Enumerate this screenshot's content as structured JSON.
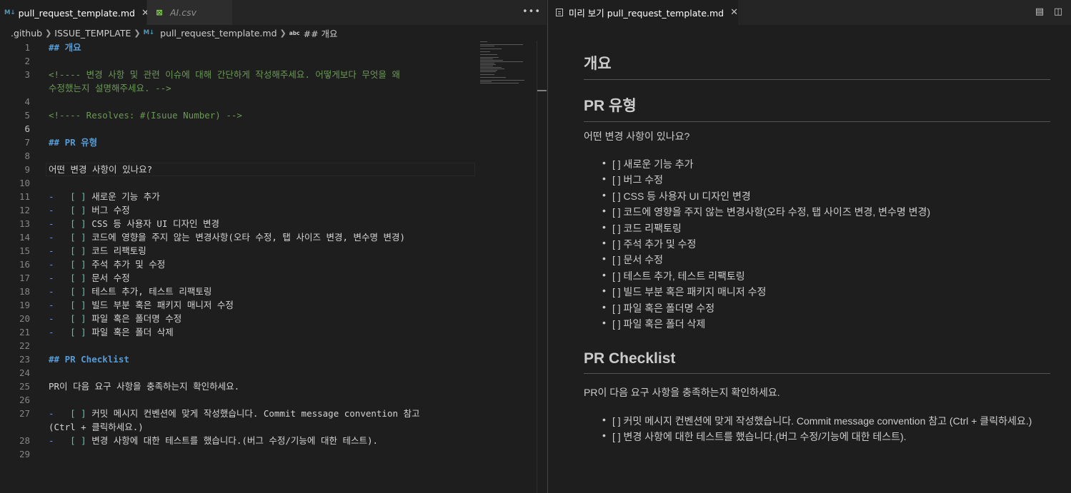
{
  "editor": {
    "tabs": [
      {
        "label": "pull_request_template.md",
        "icon": "markdown-file-icon",
        "active": true
      },
      {
        "label": "AI.csv",
        "icon": "csv-file-icon",
        "active": false
      }
    ],
    "more_actions_label": "•••",
    "breadcrumb": [
      ".github",
      "ISSUE_TEMPLATE",
      "pull_request_template.md",
      "## 개요"
    ],
    "lines": [
      {
        "n": "1",
        "text": "## 개요"
      },
      {
        "n": "2",
        "text": ""
      },
      {
        "n": "3",
        "text": "<!---- 변경 사항 및 관련 이슈에 대해 간단하게 작성해주세요. 어떻게보다 무엇을 왜"
      },
      {
        "n": "",
        "text": "수정했는지 설명해주세요. -->"
      },
      {
        "n": "4",
        "text": ""
      },
      {
        "n": "5",
        "text": "<!---- Resolves: #(Isuue Number) -->"
      },
      {
        "n": "6",
        "text": ""
      },
      {
        "n": "7",
        "text": "## PR 유형"
      },
      {
        "n": "8",
        "text": ""
      },
      {
        "n": "9",
        "text": "어떤 변경 사항이 있나요?"
      },
      {
        "n": "10",
        "text": ""
      },
      {
        "n": "11",
        "bullet": "-   ",
        "box": "[ ]",
        "text": " 새로운 기능 추가"
      },
      {
        "n": "12",
        "bullet": "-   ",
        "box": "[ ]",
        "text": " 버그 수정"
      },
      {
        "n": "13",
        "bullet": "-   ",
        "box": "[ ]",
        "text": " CSS 등 사용자 UI 디자인 변경"
      },
      {
        "n": "14",
        "bullet": "-   ",
        "box": "[ ]",
        "text": " 코드에 영향을 주지 않는 변경사항(오타 수정, 탭 사이즈 변경, 변수명 변경)"
      },
      {
        "n": "15",
        "bullet": "-   ",
        "box": "[ ]",
        "text": " 코드 리팩토링"
      },
      {
        "n": "16",
        "bullet": "-   ",
        "box": "[ ]",
        "text": " 주석 추가 및 수정"
      },
      {
        "n": "17",
        "bullet": "-   ",
        "box": "[ ]",
        "text": " 문서 수정"
      },
      {
        "n": "18",
        "bullet": "-   ",
        "box": "[ ]",
        "text": " 테스트 추가, 테스트 리팩토링"
      },
      {
        "n": "19",
        "bullet": "-   ",
        "box": "[ ]",
        "text": " 빌드 부분 혹은 패키지 매니저 수정"
      },
      {
        "n": "20",
        "bullet": "-   ",
        "box": "[ ]",
        "text": " 파일 혹은 폴더명 수정"
      },
      {
        "n": "21",
        "bullet": "-   ",
        "box": "[ ]",
        "text": " 파일 혹은 폴더 삭제"
      },
      {
        "n": "22",
        "text": ""
      },
      {
        "n": "23",
        "text": "## PR Checklist"
      },
      {
        "n": "24",
        "text": ""
      },
      {
        "n": "25",
        "text": "PR이 다음 요구 사항을 충족하는지 확인하세요."
      },
      {
        "n": "26",
        "text": ""
      },
      {
        "n": "27",
        "bullet": "-   ",
        "box": "[ ]",
        "text": " 커밋 메시지 컨벤션에 맞게 작성했습니다. Commit message convention 참고"
      },
      {
        "n": "",
        "text": "(Ctrl + 클릭하세요.)"
      },
      {
        "n": "28",
        "bullet": "-   ",
        "box": "[ ]",
        "text": " 변경 사항에 대한 테스트를 했습니다.(버그 수정/기능에 대한 테스트)."
      },
      {
        "n": "29",
        "text": ""
      }
    ]
  },
  "preview": {
    "tab_label": "미리 보기 pull_request_template.md",
    "h1": "개요",
    "h2_type": "PR 유형",
    "type_question": "어떤 변경 사항이 있나요?",
    "type_items": [
      "[ ] 새로운 기능 추가",
      "[ ] 버그 수정",
      "[ ] CSS 등 사용자 UI 디자인 변경",
      "[ ] 코드에 영향을 주지 않는 변경사항(오타 수정, 탭 사이즈 변경, 변수명 변경)",
      "[ ] 코드 리팩토링",
      "[ ] 주석 추가 및 수정",
      "[ ] 문서 수정",
      "[ ] 테스트 추가, 테스트 리팩토링",
      "[ ] 빌드 부분 혹은 패키지 매니저 수정",
      "[ ] 파일 혹은 폴더명 수정",
      "[ ] 파일 혹은 폴더 삭제"
    ],
    "h2_checklist": "PR Checklist",
    "checklist_intro": "PR이 다음 요구 사항을 충족하는지 확인하세요.",
    "checklist_items": [
      "[ ] 커밋 메시지 컨벤션에 맞게 작성했습니다. Commit message convention 참고 (Ctrl + 클릭하세요.)",
      "[ ] 변경 사항에 대한 테스트를 했습니다.(버그 수정/기능에 대한 테스트)."
    ]
  },
  "colors": {
    "background": "#1e1e1e",
    "tabbar": "#252526",
    "heading": "#569cd6",
    "comment": "#6a9955",
    "checkbox": "#4ec9b0",
    "bracket": "#ffd700"
  }
}
